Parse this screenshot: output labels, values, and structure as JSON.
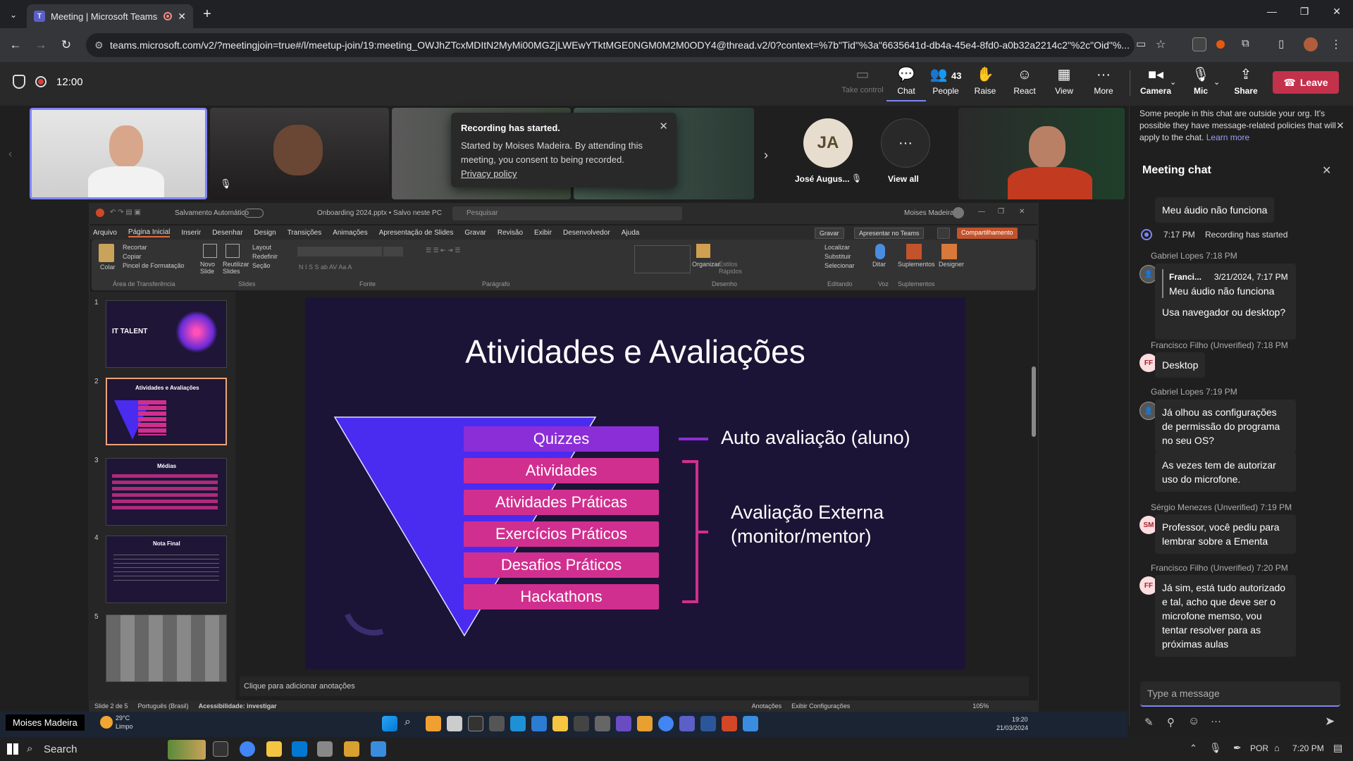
{
  "browser": {
    "tab_title": "Meeting | Microsoft Teams",
    "url": "teams.microsoft.com/v2/?meetingjoin=true#/l/meetup-join/19:meeting_OWJhZTcxMDItN2MyMi00MGZjLWEwYTktMGE0NGM0M2M0ODY4@thread.v2/0?context=%7b\"Tid\"%3a\"6635641d-db4a-45e4-8fd0-a0b32a2214c2\"%2c\"Oid\"%..."
  },
  "teams_toolbar": {
    "timer": "12:00",
    "buttons": {
      "take_control": "Take control",
      "chat": "Chat",
      "people": "People",
      "people_count": "43",
      "raise": "Raise",
      "react": "React",
      "view": "View",
      "more": "More",
      "camera": "Camera",
      "mic": "Mic",
      "share": "Share",
      "leave": "Leave"
    }
  },
  "participants": {
    "ja_initials": "JA",
    "ja_name": "José Augus...",
    "view_all": "View all"
  },
  "toast": {
    "title": "Recording has started.",
    "body": "Started by Moises Madeira. By attending this meeting, you consent to being recorded.",
    "link": "Privacy policy"
  },
  "ppt": {
    "autosave": "Salvamento Automático",
    "filename": "Onboarding 2024.pptx • Salvo neste PC",
    "search": "Pesquisar",
    "user": "Moises Madeira",
    "menu": [
      "Arquivo",
      "Página Inicial",
      "Inserir",
      "Desenhar",
      "Design",
      "Transições",
      "Animações",
      "Apresentação de Slides",
      "Gravar",
      "Revisão",
      "Exibir",
      "Desenvolvedor",
      "Ajuda"
    ],
    "gravar_btn": "Gravar",
    "teams_btn": "Apresentar no Teams",
    "share_btn": "Compartilhamento",
    "ribbon_groups": [
      "Área de Transferência",
      "Slides",
      "Fonte",
      "Parágrafo",
      "Desenho",
      "Editando",
      "Voz",
      "Suplementos"
    ],
    "ribbon_items": {
      "colar": "Colar",
      "recortar": "Recortar",
      "copiar": "Copiar",
      "pincel": "Pincel de Formatação",
      "novo_slide": "Novo Slide",
      "reutilizar": "Reutilizar Slides",
      "layout": "Layout",
      "redefinir": "Redefinir",
      "secao": "Seção",
      "organizar": "Organizar",
      "estilos": "Estilos Rápidos",
      "localizar": "Localizar",
      "substituir": "Substituir",
      "selecionar": "Selecionar",
      "ditar": "Ditar",
      "suplementos": "Suplementos",
      "designer": "Designer"
    },
    "notes_placeholder": "Clique para adicionar anotações",
    "status": {
      "slide": "Slide 2 de 5",
      "lang": "Português (Brasil)",
      "accessibility": "Acessibilidade: investigar",
      "anotacoes": "Anotações",
      "exibir": "Exibir Configurações",
      "zoom": "105%"
    },
    "thumbnails": {
      "t1_title": "IT TALENT",
      "t2_title": "Atividades e Avaliações",
      "t3_title": "Médias",
      "t4_title": "Nota Final"
    }
  },
  "slide": {
    "title": "Atividades e Avaliações",
    "items": [
      "Quizzes",
      "Atividades",
      "Atividades Práticas",
      "Exercícios Práticos",
      "Desafios Práticos",
      "Hackathons"
    ],
    "label_self": "Auto avaliação (aluno)",
    "label_external_1": "Avaliação Externa",
    "label_external_2": "(monitor/mentor)"
  },
  "chat": {
    "banner": "Some people in this chat are outside your org. It's possible they have message-related policies that will apply to the chat.",
    "banner_link": "Learn more",
    "title": "Meeting chat",
    "input_placeholder": "Type a message",
    "messages": {
      "m0": "Meu áudio não funciona",
      "rec_time": "7:17 PM",
      "rec_text": "Recording has started",
      "gl1_meta": "Gabriel Lopes  7:18 PM",
      "quote_name": "Franci...",
      "quote_date": "3/21/2024, 7:17 PM",
      "quote_text": "Meu áudio não funciona",
      "gl1_text": "Usa navegador ou desktop?",
      "ff1_meta": "Francisco Filho (Unverified)  7:18 PM",
      "ff1_text": "Desktop",
      "gl2_meta": "Gabriel Lopes  7:19 PM",
      "gl2_text": "Já olhou as configurações de permissão do programa no seu OS?",
      "gl3_text": "As vezes tem de autorizar uso do microfone.",
      "sm_meta": "Sérgio Menezes (Unverified)  7:19 PM",
      "sm_text": "Professor, você pediu para lembrar sobre a Ementa",
      "ff2_meta": "Francisco Filho (Unverified)  7:20 PM",
      "ff2_text": "Já sim, está tudo autorizado e tal, acho que deve ser o microfone memso, vou tentar resolver para as próximas aulas",
      "ff_initials": "FF",
      "sm_initials": "SM"
    }
  },
  "taskbar": {
    "presenter": "Moises Madeira",
    "weather_temp": "29°C",
    "weather_desc": "Limpo",
    "search": "Search",
    "clock_inner": "19:20",
    "date_inner": "21/03/2024",
    "lang": "POR",
    "clock": "7:20 PM"
  },
  "colors": {
    "teams_accent": "#7f85f5",
    "leave_red": "#c4314b",
    "slide_bg": "#1c1436",
    "pill_pink": "#d12f8f",
    "pill_purple": "#8b2ed8",
    "triangle_blue": "#4a2bf0"
  }
}
